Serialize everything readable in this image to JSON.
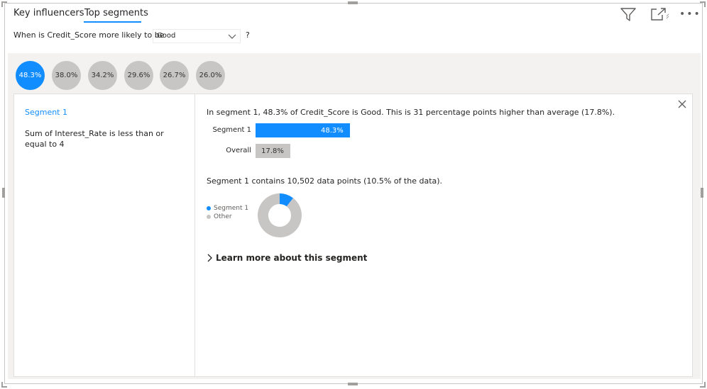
{
  "tabs": [
    {
      "label": "Key influencers",
      "active": false
    },
    {
      "label": "Top segments",
      "active": true
    }
  ],
  "toolbar": {
    "icons": [
      "filter-icon",
      "focus-mode-icon",
      "more-options-icon"
    ],
    "more_label": "•••"
  },
  "question": {
    "prefix": "When is Credit_Score more likely to be",
    "selected_value": "Good",
    "suffix": "?"
  },
  "segments": [
    {
      "label": "48.3%",
      "active": true
    },
    {
      "label": "38.0%",
      "active": false
    },
    {
      "label": "34.2%",
      "active": false
    },
    {
      "label": "29.6%",
      "active": false
    },
    {
      "label": "26.7%",
      "active": false
    },
    {
      "label": "26.0%",
      "active": false
    }
  ],
  "detail": {
    "segment_title": "Segment 1",
    "rule": "Sum of Interest_Rate is less than or equal to 4",
    "summary": "In segment 1, 48.3% of Credit_Score is Good. This is 31 percentage points higher than average (17.8%).",
    "contains": "Segment 1 contains 10,502 data points (10.5% of the data).",
    "learn_more": "Learn more about this segment"
  },
  "chart_data": [
    {
      "type": "bar",
      "categories": [
        "Segment 1",
        "Overall"
      ],
      "values": [
        48.3,
        17.8
      ],
      "value_labels": [
        "48.3%",
        "17.8%"
      ],
      "colors": [
        "#118dff",
        "#c8c6c4"
      ],
      "xlim": [
        0,
        100
      ]
    },
    {
      "type": "pie",
      "donut": true,
      "categories": [
        "Segment 1",
        "Other"
      ],
      "values": [
        10.5,
        89.5
      ],
      "colors": [
        "#118dff",
        "#c8c6c4"
      ],
      "legend_placement": "left"
    }
  ],
  "colors": {
    "accent": "#118dff",
    "neutral": "#c8c6c4"
  }
}
